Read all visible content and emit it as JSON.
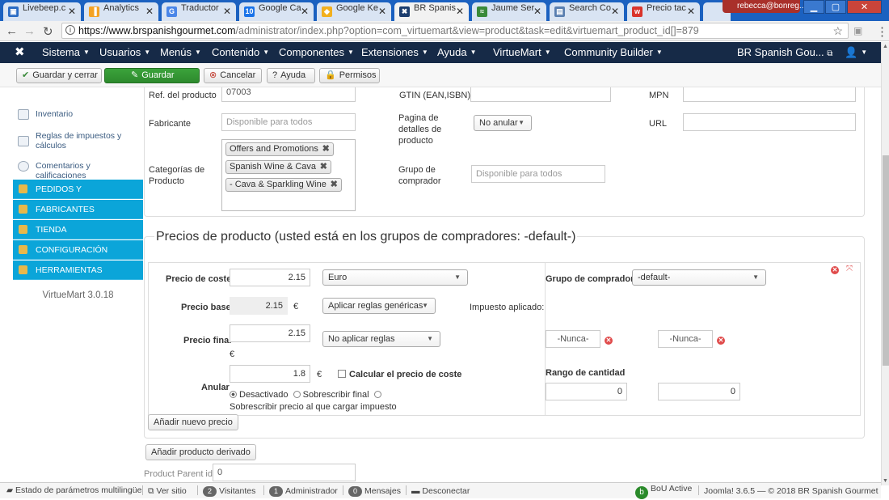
{
  "browser": {
    "tabs": [
      {
        "label": "Livebeep.c",
        "fav_color": "#2b6cc4",
        "fav": "▣"
      },
      {
        "label": "Analytics",
        "fav_color": "#f4a223",
        "fav": "▐"
      },
      {
        "label": "Traductor",
        "fav_color": "#4a86e8",
        "fav": "G"
      },
      {
        "label": "Google Ca",
        "fav_color": "#1a73e8",
        "fav": "10"
      },
      {
        "label": "Google Ke",
        "fav_color": "#f2b01e",
        "fav": "◆"
      },
      {
        "label": "BR Spanis",
        "fav_color": "#1c3d6e",
        "fav": "✖",
        "active": true
      },
      {
        "label": "Jaume Ser",
        "fav_color": "#3a8a3a",
        "fav": "≈"
      },
      {
        "label": "Search Co",
        "fav_color": "#5a7fb0",
        "fav": "▤"
      },
      {
        "label": "Precio tac",
        "fav_color": "#d9342b",
        "fav": "w"
      }
    ],
    "profile": "rebecca@bonreg...",
    "url_host": "https://www.brspanishgourmet.com",
    "url_path": "/administrator/index.php?option=com_virtuemart&view=product&task=edit&virtuemart_product_id[]=879"
  },
  "topnav": {
    "menus": [
      "Sistema",
      "Usuarios",
      "Menús",
      "Contenido",
      "Componentes",
      "Extensiones",
      "Ayuda",
      "VirtueMart",
      "Community Builder"
    ],
    "site": "BR Spanish Gou..."
  },
  "toolbar": {
    "save_close": "Guardar y cerrar",
    "save": "Guardar",
    "cancel": "Cancelar",
    "help": "Ayuda",
    "perms": "Permisos"
  },
  "sidebar": {
    "items": [
      "Inventario",
      "Reglas de impuestos y cálculos",
      "Comentarios y calificaciones"
    ],
    "sections": [
      "PEDIDOS Y",
      "FABRICANTES",
      "TIENDA",
      "CONFIGURACIÓN",
      "HERRAMIENTAS"
    ],
    "version": "VirtueMart 3.0.18"
  },
  "product": {
    "sku_label": "Ref. del producto",
    "sku_value": "07003",
    "gtin_label": "GTIN (EAN,ISBN)",
    "gtin_value": "",
    "mpn_label": "MPN",
    "mpn_value": "",
    "manufacturer_label": "Fabricante",
    "manufacturer_placeholder": "Disponible para todos",
    "detail_page_label": "Pagina de detalles de producto",
    "detail_page_value": "No anular",
    "url_label": "URL",
    "url_value": "",
    "categories_label": "Categorías de Producto",
    "categories": [
      "Offers and Promotions",
      "Spanish Wine & Cava",
      "- Cava & Sparkling Wine"
    ],
    "shopper_group_label": "Grupo de comprador",
    "shopper_group_placeholder": "Disponible para todos"
  },
  "prices": {
    "title": "Precios de producto (usted está en los grupos de compradores: -default-)",
    "cost_label": "Precio de coste",
    "cost_value": "2.15",
    "currency": "Euro",
    "base_label": "Precio base",
    "base_value": "2.15",
    "euro_sign": "€",
    "base_rule": "Aplicar reglas genéricas",
    "tax_applied": "Impuesto aplicado:",
    "final_label": "Precio final",
    "final_value": "2.15",
    "final_rule": "No aplicar reglas",
    "override_label": "Anular",
    "override_value": "1.8",
    "calc_cost": "Calcular el precio de coste",
    "radio_off": "Desactivado",
    "radio_final": "Sobrescribir final",
    "radio_tax": "Sobrescribir precio al que cargar impuesto",
    "shopper_group_label": "Grupo de comprador",
    "shopper_group_value": "-default-",
    "never1": "-Nunca-",
    "never2": "-Nunca-",
    "qty_label": "Rango de cantidad",
    "qty_from": "0",
    "qty_to": "0",
    "add_price": "Añadir nuevo precio"
  },
  "derived": {
    "add_button": "Añadir producto derivado",
    "parent_label": "Product Parent id",
    "parent_value": "0"
  },
  "status": {
    "multilang": "Estado de parámetros multilingüe",
    "view_site": "Ver sitio",
    "visitors_count": "2",
    "visitors": "Visitantes",
    "admins_count": "1",
    "admins": "Administrador",
    "messages_count": "0",
    "messages": "Mensajes",
    "logout": "Desconectar",
    "bou": "BoU Active",
    "version": "Joomla! 3.6.5 — © 2018 BR Spanish Gourmet"
  }
}
